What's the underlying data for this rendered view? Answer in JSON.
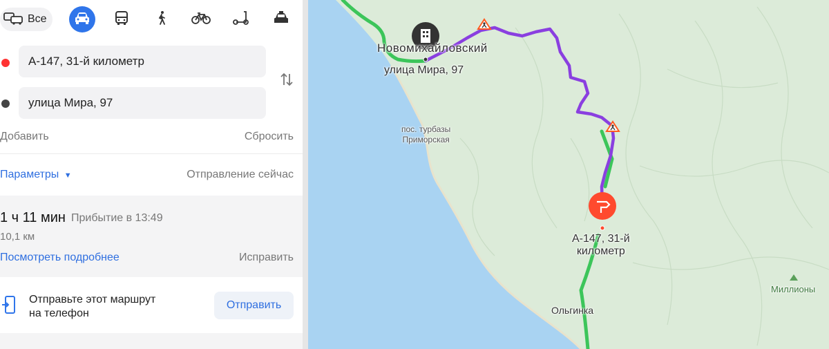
{
  "modes": {
    "all_label": "Все",
    "items": [
      {
        "icon": "car-icon",
        "active": true
      },
      {
        "icon": "bus-icon",
        "active": false
      },
      {
        "icon": "walk-icon",
        "active": false
      },
      {
        "icon": "bicycle-icon",
        "active": false
      },
      {
        "icon": "scooter-icon",
        "active": false
      },
      {
        "icon": "taxi-icon",
        "active": false
      }
    ]
  },
  "route_form": {
    "from_value": "А-147, 31-й километр",
    "to_value": "улица Мира, 97",
    "add_label": "Добавить",
    "reset_label": "Сбросить",
    "swap_icon": "swap-icon",
    "colors": {
      "from_dot": "#ff3333",
      "to_dot": "#444444"
    }
  },
  "params": {
    "label": "Параметры",
    "departure": "Отправление сейчас"
  },
  "route": {
    "duration": "1 ч 11 мин",
    "arrival": "Прибытие в 13:49",
    "distance": "10,1 км",
    "details_link": "Посмотреть подробнее",
    "fix_label": "Исправить"
  },
  "send": {
    "text_line1": "Отправьте этот маршрут",
    "text_line2": "на телефон",
    "button_label": "Отправить"
  },
  "map": {
    "labels": {
      "town_novomikhailovsky": "Новомихайловский",
      "dest_address": "улица Мира, 97",
      "resort_line1": "пос. турбазы",
      "resort_line2": "Приморская",
      "start_line1": "А-147, 31-й",
      "start_line2": "километр",
      "olginka": "Ольгинка",
      "milliony": "Миллионы"
    },
    "colors": {
      "sea": "#a9d3f2",
      "land": "#dcebd9",
      "route": "#8a3fe0",
      "start_pin": "#ff4a2e",
      "highway": "#3cc55a"
    }
  }
}
